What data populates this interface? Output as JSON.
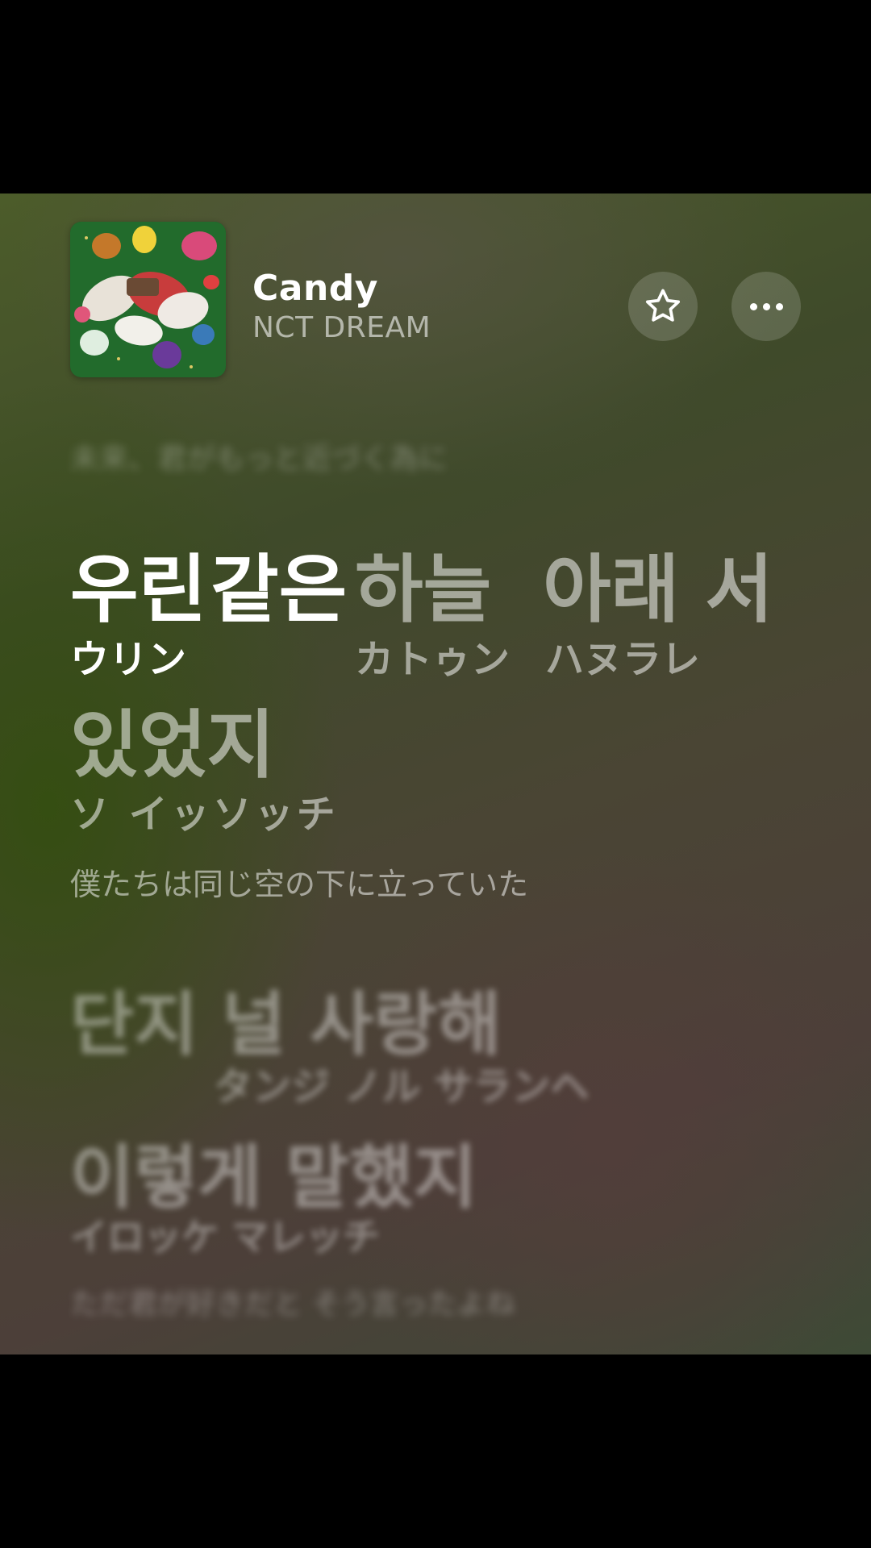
{
  "track": {
    "title": "Candy",
    "artist": "NCT DREAM"
  },
  "buttons": {
    "favorite_icon": "star-outline-icon",
    "more_icon": "ellipsis-icon"
  },
  "lyrics": {
    "previous_translation": "未来、君がもっと近づく為に",
    "current_words": [
      {
        "kr": "우린",
        "jp": "ウリン",
        "active": true
      },
      {
        "kr": "같은",
        "jp": "",
        "active": true
      },
      {
        "kr": "하늘",
        "jp": "カトゥン",
        "active": false
      },
      {
        "kr": "아래 서",
        "jp": "ハヌラレ",
        "active": false
      }
    ],
    "current_line2_kr": "있었지",
    "current_line2_jp": "ソ イッソッチ",
    "current_translation": "僕たちは同じ空の下に立っていた",
    "next_line1_kr": "단지 널 사랑해",
    "next_line1_jp": "タンジ ノル サランヘ",
    "next_line2_kr": "이렇게 말했지",
    "next_line2_jp": "イロッケ マレッチ",
    "next_translation": "ただ君が好きだと そう言ったよね"
  }
}
